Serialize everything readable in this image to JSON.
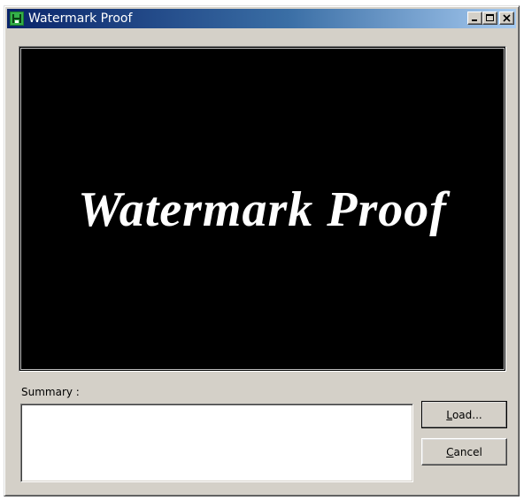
{
  "window": {
    "title": "Watermark Proof",
    "icon": "watermark-app-icon",
    "caption_buttons": [
      "minimize",
      "maximize",
      "close"
    ]
  },
  "preview": {
    "text": "Watermark Proof",
    "background_color": "#000000",
    "text_color": "#ffffff"
  },
  "summary": {
    "label": "Summary :",
    "value": ""
  },
  "buttons": {
    "load": {
      "mnemonic": "L",
      "rest": "oad..."
    },
    "cancel": {
      "mnemonic": "C",
      "rest": "ancel"
    }
  },
  "colors": {
    "face": "#d4d0c8",
    "titlebar_start": "#0a246a",
    "titlebar_end": "#a6caf0"
  }
}
